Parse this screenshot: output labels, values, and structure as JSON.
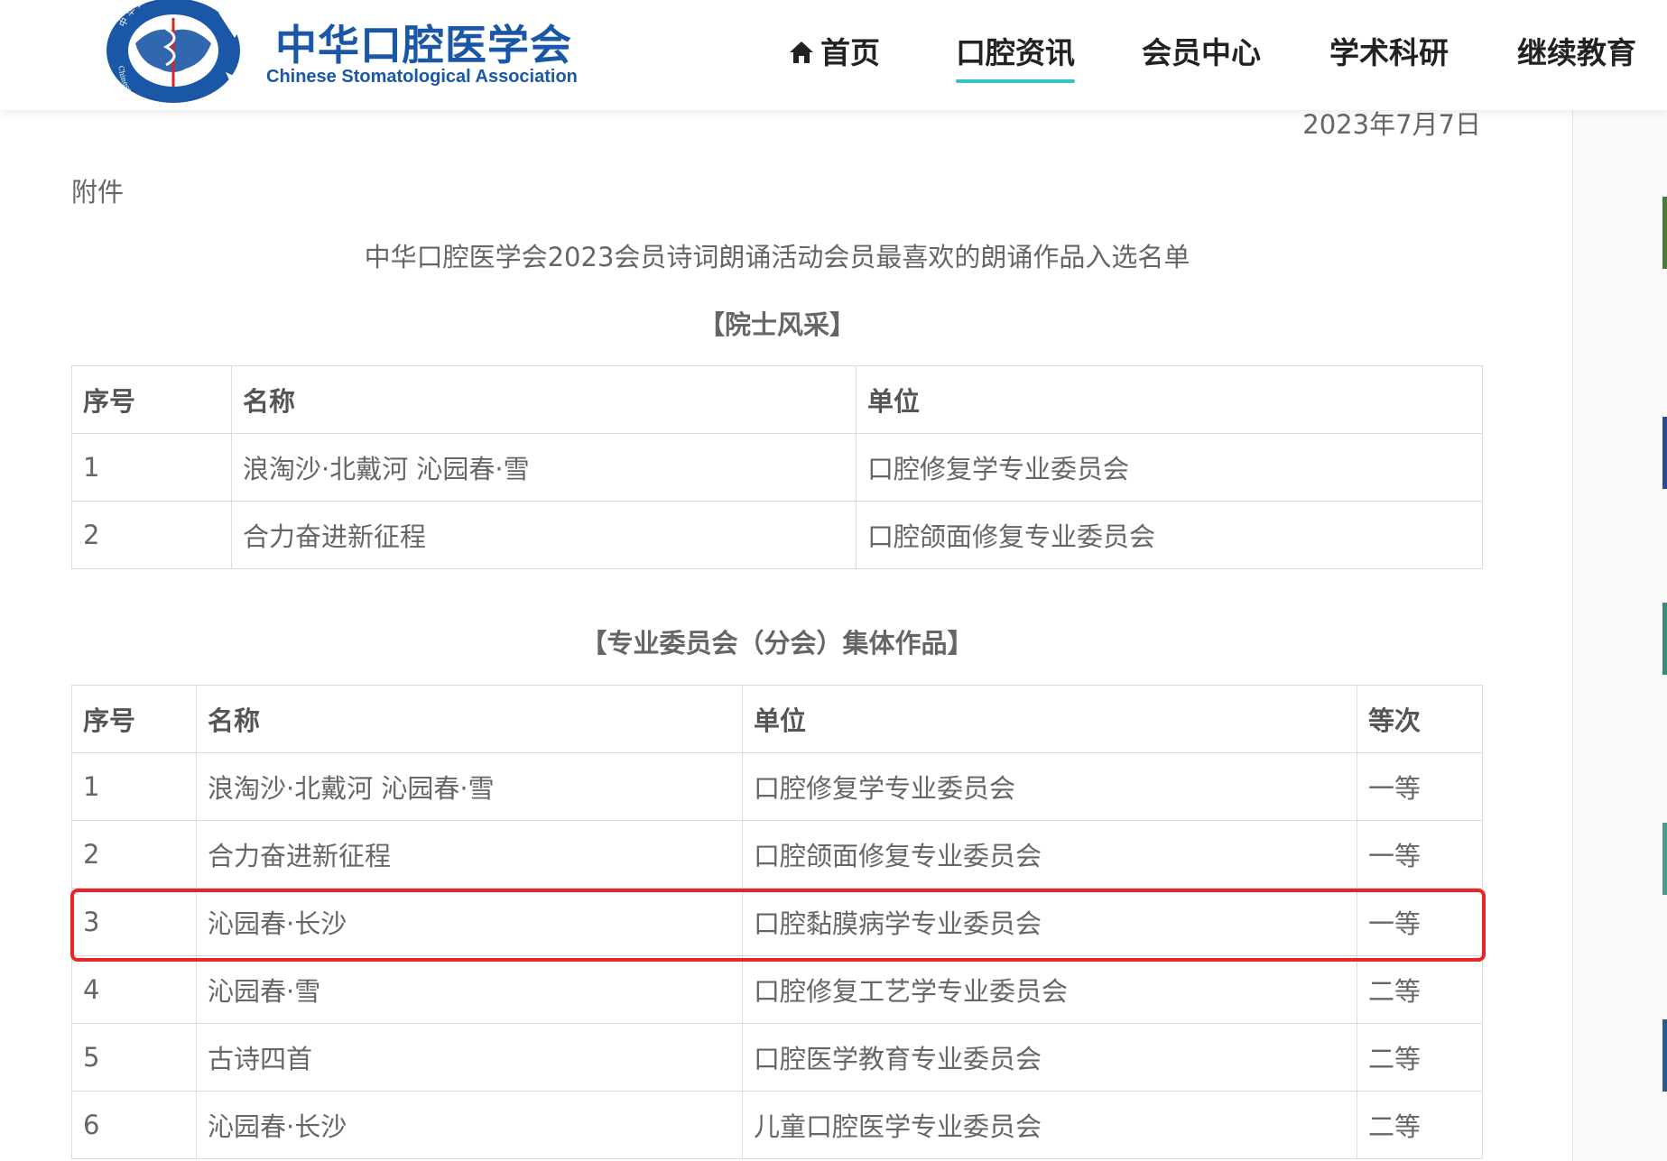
{
  "header": {
    "logo_cn": "中华口腔医学会",
    "logo_en": "Chinese Stomatological Association",
    "emblem_top_text": "中 华 口 腔 医 学 会",
    "emblem_bottom_text": "Chinese Stomatological Association",
    "brand_color": "#1a57a6",
    "nav": [
      {
        "label": "首页",
        "icon": "home-icon"
      },
      {
        "label": "口腔资讯",
        "active": true
      },
      {
        "label": "会员中心"
      },
      {
        "label": "学术科研"
      },
      {
        "label": "继续教育"
      }
    ],
    "active_underline_color": "#33c3c3"
  },
  "article": {
    "date": "2023年7月7日",
    "attachment_label": "附件",
    "title": "中华口腔医学会2023会员诗词朗诵活动会员最喜欢的朗诵作品入选名单",
    "section1": {
      "title": "【院士风采】",
      "headers": [
        "序号",
        "名称",
        "单位"
      ],
      "rows": [
        [
          "1",
          "浪淘沙·北戴河 沁园春·雪",
          "口腔修复学专业委员会"
        ],
        [
          "2",
          "合力奋进新征程",
          "口腔颌面修复专业委员会"
        ]
      ]
    },
    "section2": {
      "title": "【专业委员会（分会）集体作品】",
      "headers": [
        "序号",
        "名称",
        "单位",
        "等次"
      ],
      "rows": [
        [
          "1",
          "浪淘沙·北戴河 沁园春·雪",
          "口腔修复学专业委员会",
          "一等"
        ],
        [
          "2",
          "合力奋进新征程",
          "口腔颌面修复专业委员会",
          "一等"
        ],
        [
          "3",
          "沁园春·长沙",
          "口腔黏膜病学专业委员会",
          "一等"
        ],
        [
          "4",
          "沁园春·雪",
          "口腔修复工艺学专业委员会",
          "二等"
        ],
        [
          "5",
          "古诗四首",
          "口腔医学教育专业委员会",
          "二等"
        ],
        [
          "6",
          "沁园春·长沙",
          "儿童口腔医学专业委员会",
          "二等"
        ]
      ],
      "highlighted_row": 3,
      "highlight_color": "#e8262a"
    }
  }
}
